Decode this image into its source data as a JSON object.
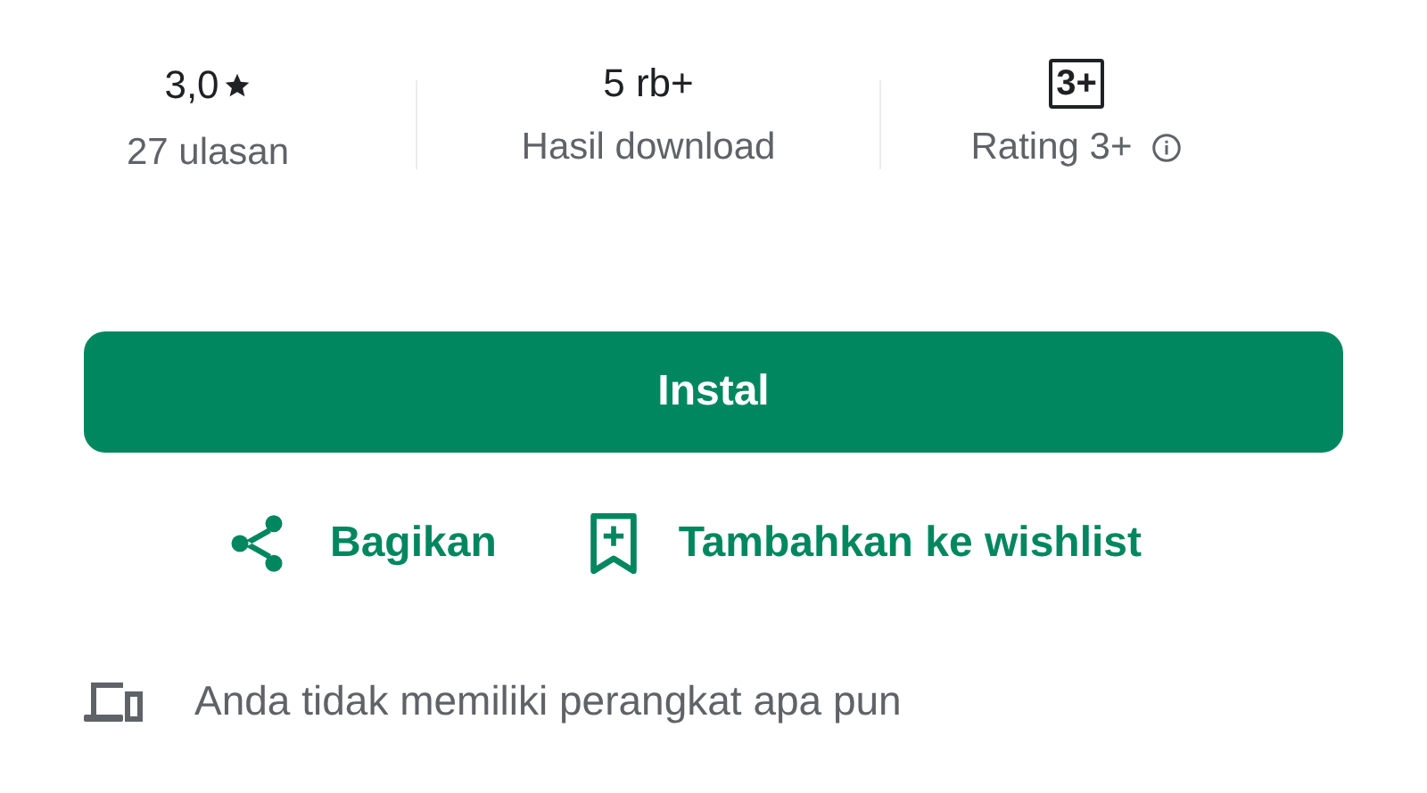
{
  "stats": [
    {
      "kind": "rating",
      "value": "3,0",
      "label": "27 ulasan"
    },
    {
      "kind": "plain",
      "value": "5 rb+",
      "label": "Hasil download"
    },
    {
      "kind": "content_rating",
      "value": "3+",
      "label": "Rating 3+"
    }
  ],
  "install_button": {
    "label": "Instal"
  },
  "actions": [
    {
      "kind": "share",
      "label": "Bagikan"
    },
    {
      "kind": "wishlist",
      "label": "Tambahkan ke wishlist"
    }
  ],
  "device_notice": {
    "text": "Anda tidak memiliki perangkat apa pun"
  }
}
